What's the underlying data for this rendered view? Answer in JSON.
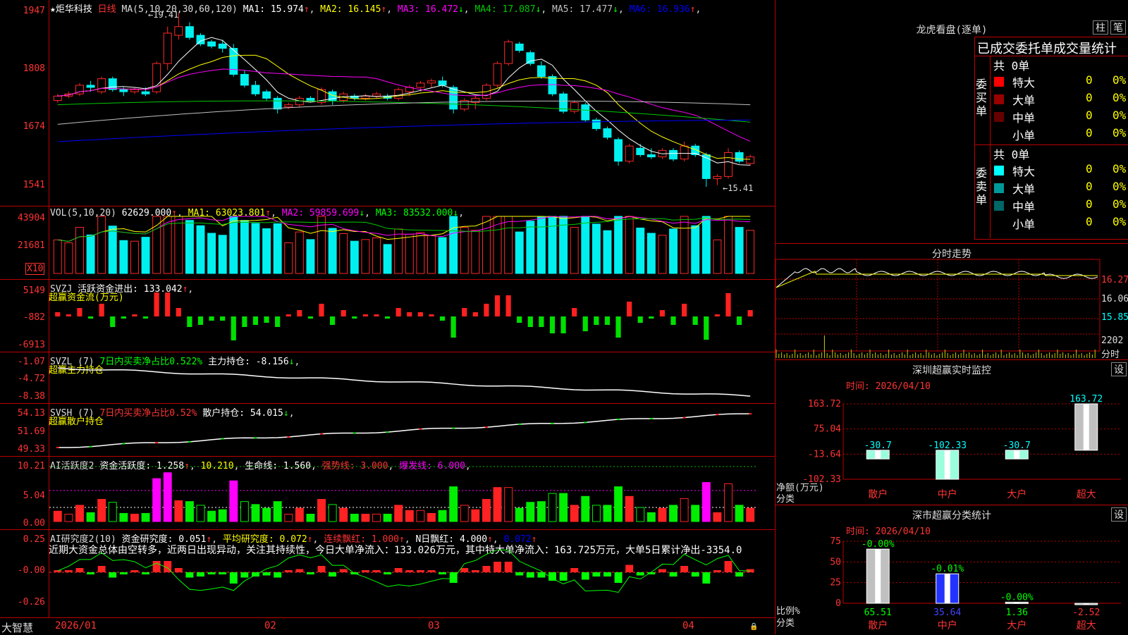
{
  "colors": {
    "up": "#ff2828",
    "down": "#00f0f0",
    "bg": "#000000",
    "grid": "#aa0000",
    "label": "#ff3333",
    "ma1": "#ffffff",
    "ma2": "#ffff00",
    "ma3": "#ff00ff",
    "ma4": "#00c800",
    "ma5": "#c0c0c0",
    "ma6": "#0000ff",
    "green": "#00ff00"
  },
  "main": {
    "star": "★",
    "name": "炬华科技",
    "period": "日线",
    "ma_head": "MA(5,10,20,30,60,120)",
    "ma": [
      {
        "label": "MA1: 15.974",
        "arrow": "↑",
        "color": "#ffffff",
        "arrow_color": "#ff3030"
      },
      {
        "label": "MA2: 16.145",
        "arrow": "↑",
        "color": "#ffff00",
        "arrow_color": "#ff3030"
      },
      {
        "label": "MA3: 16.472",
        "arrow": "↓",
        "color": "#ff00ff",
        "arrow_color": "#00ff00"
      },
      {
        "label": "MA4: 17.087",
        "arrow": "↓",
        "color": "#00c800",
        "arrow_color": "#00ff00"
      },
      {
        "label": "MA5: 17.477",
        "arrow": "↓",
        "color": "#c0c0c0",
        "arrow_color": "#00ff00"
      },
      {
        "label": "MA6: 16.936",
        "arrow": "↑",
        "color": "#0000ff",
        "arrow_color": "#ff3030"
      }
    ],
    "yticks": [
      "1947",
      "1808",
      "1674",
      "1541"
    ],
    "hi_label": "19.41",
    "lo_label": "15.41"
  },
  "vol": {
    "head": "VOL(5,10,20)",
    "value": "62629.000",
    "arrow0": "↑",
    "ma": [
      {
        "label": "MA1: 63023.801",
        "arrow": "↑",
        "color": "#ffff00"
      },
      {
        "label": "MA2: 59859.699",
        "arrow": "↓",
        "color": "#ff00ff"
      },
      {
        "label": "MA3: 83532.000",
        "arrow": "↓",
        "color": "#00ff00"
      }
    ],
    "yticks": [
      "43904",
      "21681"
    ],
    "unit": "X10"
  },
  "svzj": {
    "head": "SVZJ",
    "text": "活跃资金进出: 133.042",
    "arrow": "↑",
    "sub": "超赢资金流(万元)",
    "yticks": [
      "5149",
      "-882",
      "-6913"
    ]
  },
  "svzl": {
    "head": "SVZL (7)",
    "text1": "7日内买卖净占比0.522%",
    "text2": "主力持仓: -8.156",
    "arrow": "↓",
    "sub": "超赢主力持仓",
    "yticks": [
      "-1.07",
      "-4.72",
      "-8.38"
    ]
  },
  "svsh": {
    "head": "SVSH (7)",
    "text1": "7日内买卖净占比0.52%",
    "text2": "散户持仓: 54.015",
    "arrow": "↓",
    "sub": "超赢散户持仓",
    "yticks": [
      "54.13",
      "51.69",
      "49.33"
    ]
  },
  "ai1": {
    "head": "AI活跃度2",
    "text": "资金活跃度: 1.258",
    "v2": "10.210",
    "v3": "生命线: 1.560",
    "v4": "强势线: 3.000",
    "v5": "爆发线: 6.000",
    "yticks": [
      "10.21",
      "5.04",
      "0.00"
    ]
  },
  "ai2": {
    "head": "AI研究度2(10)",
    "t1": "资金研究度: 0.051",
    "t2": "平均研究度: 0.072",
    "t3": "连续飘红: 1.000",
    "t4": "N日飘红: 4.000",
    "t5": "0.072",
    "comment": "近期大资金总体由空转多，近两日出现异动，关注其持续性，今日大单净流入：133.026万元，其中特大单净流入：163.725万元，大单5日累计净出-3354.0",
    "yticks": [
      "0.25",
      "-0.00",
      "-0.26"
    ]
  },
  "xaxis": {
    "labels": [
      "2026/01",
      "02",
      "03",
      "04"
    ]
  },
  "brand": "大智慧",
  "dragon": {
    "title": "龙虎看盘(逐单)",
    "btn1": "柱",
    "btn2": "笔",
    "header": "已成交委托单成交量统计",
    "buy": {
      "side": "委买单",
      "total": "共 0单",
      "rows": [
        {
          "name": "特大",
          "v": "0",
          "p": "0%",
          "color": "#ff0000"
        },
        {
          "name": "大单",
          "v": "0",
          "p": "0%",
          "color": "#990000"
        },
        {
          "name": "中单",
          "v": "0",
          "p": "0%",
          "color": "#660000"
        },
        {
          "name": "小单",
          "v": "0",
          "p": "0%",
          "color": ""
        }
      ]
    },
    "sell": {
      "side": "委卖单",
      "total": "共 0单",
      "rows": [
        {
          "name": "特大",
          "v": "0",
          "p": "0%",
          "color": "#00ffff"
        },
        {
          "name": "大单",
          "v": "0",
          "p": "0%",
          "color": "#009999"
        },
        {
          "name": "中单",
          "v": "0",
          "p": "0%",
          "color": "#006666"
        },
        {
          "name": "小单",
          "v": "0",
          "p": "0%",
          "color": ""
        }
      ]
    }
  },
  "intraday": {
    "title": "分时走势",
    "yticks": [
      "16.27",
      "16.06",
      "15.85"
    ],
    "vol": "2202",
    "vol_label": "分时"
  },
  "monitor": {
    "title": "深圳超赢实时监控",
    "settings": "设",
    "date": "时间: 2026/04/10",
    "yticks": [
      "163.72",
      "75.04",
      "-13.64",
      "-102.33"
    ],
    "ylabel": "净额(万元)",
    "xlabel": "分类",
    "chart_data": {
      "type": "bar",
      "categories": [
        "散户",
        "中户",
        "大户",
        "超大"
      ],
      "values": [
        -30.7,
        -102.33,
        -30.7,
        163.72
      ],
      "labels": [
        "-30.7",
        "-102.33",
        "-30.7",
        "163.72"
      ],
      "ylim": [
        -102.33,
        163.72
      ]
    }
  },
  "classify": {
    "title": "深市超赢分类统计",
    "settings": "设",
    "date": "时间: 2026/04/10",
    "yticks": [
      "75",
      "50",
      "25",
      "0"
    ],
    "ylabel": "比例%",
    "xlabel": "分类",
    "chart_data": {
      "type": "bar",
      "categories": [
        "散户",
        "中户",
        "大户",
        "超大"
      ],
      "values": [
        65.51,
        35.64,
        1.36,
        -2.52
      ],
      "values_label": [
        "65.51",
        "35.64",
        "1.36",
        "-2.52"
      ],
      "top_labels": [
        "-0.00%",
        "-0.01%",
        "-0.00%",
        ""
      ],
      "ylim": [
        0,
        75
      ]
    }
  },
  "chart_data": [
    {
      "type": "bar",
      "title": "深圳超赢实时监控",
      "categories": [
        "散户",
        "中户",
        "大户",
        "超大"
      ],
      "values": [
        -30.7,
        -102.33,
        -30.7,
        163.72
      ]
    },
    {
      "type": "bar",
      "title": "深市超赢分类统计",
      "categories": [
        "散户",
        "中户",
        "大户",
        "超大"
      ],
      "values": [
        65.51,
        35.64,
        1.36,
        -2.52
      ]
    }
  ],
  "candles": [
    [
      17.4,
      17.55,
      17.35,
      17.5
    ],
    [
      17.5,
      17.6,
      17.45,
      17.55
    ],
    [
      17.55,
      17.8,
      17.5,
      17.75
    ],
    [
      17.75,
      17.85,
      17.6,
      17.7
    ],
    [
      17.6,
      17.95,
      17.55,
      17.9
    ],
    [
      17.9,
      17.95,
      17.6,
      17.65
    ],
    [
      17.65,
      17.7,
      17.5,
      17.6
    ],
    [
      17.6,
      17.7,
      17.55,
      17.65
    ],
    [
      17.6,
      17.7,
      17.5,
      17.55
    ],
    [
      17.6,
      18.3,
      17.55,
      18.25
    ],
    [
      18.25,
      19.1,
      18.1,
      18.95
    ],
    [
      18.9,
      19.41,
      18.8,
      19.1
    ],
    [
      19.1,
      19.2,
      18.8,
      18.85
    ],
    [
      18.9,
      18.95,
      18.65,
      18.7
    ],
    [
      18.75,
      18.8,
      18.6,
      18.65
    ],
    [
      18.7,
      18.8,
      18.5,
      18.6
    ],
    [
      18.6,
      18.7,
      17.95,
      18.0
    ],
    [
      18.0,
      18.1,
      17.7,
      17.75
    ],
    [
      17.75,
      17.85,
      17.5,
      17.55
    ],
    [
      17.6,
      17.65,
      17.4,
      17.45
    ],
    [
      17.45,
      17.5,
      17.1,
      17.2
    ],
    [
      17.25,
      17.35,
      17.2,
      17.3
    ],
    [
      17.3,
      17.5,
      17.25,
      17.45
    ],
    [
      17.45,
      17.5,
      17.35,
      17.4
    ],
    [
      17.35,
      17.7,
      17.3,
      17.65
    ],
    [
      17.6,
      17.65,
      17.3,
      17.4
    ],
    [
      17.4,
      17.6,
      17.35,
      17.55
    ],
    [
      17.5,
      17.55,
      17.4,
      17.45
    ],
    [
      17.45,
      17.55,
      17.4,
      17.5
    ],
    [
      17.5,
      17.6,
      17.45,
      17.55
    ],
    [
      17.5,
      17.55,
      17.4,
      17.45
    ],
    [
      17.45,
      17.7,
      17.4,
      17.65
    ],
    [
      17.6,
      17.75,
      17.5,
      17.7
    ],
    [
      17.7,
      17.85,
      17.6,
      17.8
    ],
    [
      17.8,
      17.9,
      17.7,
      17.85
    ],
    [
      17.85,
      17.95,
      17.7,
      17.75
    ],
    [
      17.7,
      17.75,
      17.1,
      17.2
    ],
    [
      17.2,
      17.45,
      17.15,
      17.4
    ],
    [
      17.35,
      17.5,
      17.2,
      17.45
    ],
    [
      17.45,
      17.8,
      17.4,
      17.75
    ],
    [
      17.75,
      18.3,
      17.7,
      18.25
    ],
    [
      18.25,
      18.8,
      18.2,
      18.75
    ],
    [
      18.7,
      18.75,
      18.5,
      18.55
    ],
    [
      18.5,
      18.55,
      18.2,
      18.25
    ],
    [
      18.2,
      18.3,
      17.9,
      17.95
    ],
    [
      17.95,
      18.0,
      17.5,
      17.55
    ],
    [
      17.55,
      17.6,
      17.1,
      17.15
    ],
    [
      17.15,
      17.4,
      17.1,
      17.35
    ],
    [
      17.3,
      17.35,
      16.9,
      16.95
    ],
    [
      16.95,
      17.0,
      16.7,
      16.75
    ],
    [
      16.75,
      16.8,
      16.5,
      16.55
    ],
    [
      16.5,
      16.55,
      15.9,
      16.0
    ],
    [
      16.0,
      16.4,
      15.95,
      16.35
    ],
    [
      16.3,
      16.4,
      16.1,
      16.15
    ],
    [
      16.15,
      16.3,
      16.05,
      16.1
    ],
    [
      16.1,
      16.3,
      16.05,
      16.25
    ],
    [
      16.25,
      16.3,
      16.0,
      16.05
    ],
    [
      16.05,
      16.45,
      16.0,
      16.35
    ],
    [
      16.35,
      16.4,
      16.1,
      16.15
    ],
    [
      16.15,
      16.2,
      15.41,
      15.6
    ],
    [
      15.6,
      15.7,
      15.45,
      15.65
    ],
    [
      15.65,
      16.3,
      15.6,
      16.2
    ],
    [
      16.2,
      16.25,
      15.95,
      16.0
    ],
    [
      15.95,
      16.15,
      15.9,
      16.1
    ]
  ]
}
